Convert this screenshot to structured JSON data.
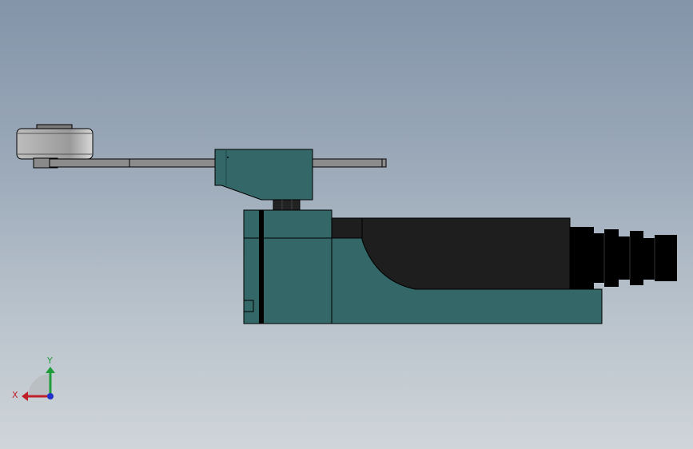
{
  "viewport": {
    "background_top": "#8494a9",
    "background_bottom": "#cfd5d9"
  },
  "model": {
    "body_color": "#346868",
    "boot_color": "#1e1e1e",
    "roller_color": "#a9a9a9",
    "lever_color": "#8c8c8c"
  },
  "triad": {
    "x_label": "X",
    "y_label": "Y",
    "x_color": "#c0202a",
    "y_color": "#1f9d3a",
    "z_color": "#2030c8"
  }
}
